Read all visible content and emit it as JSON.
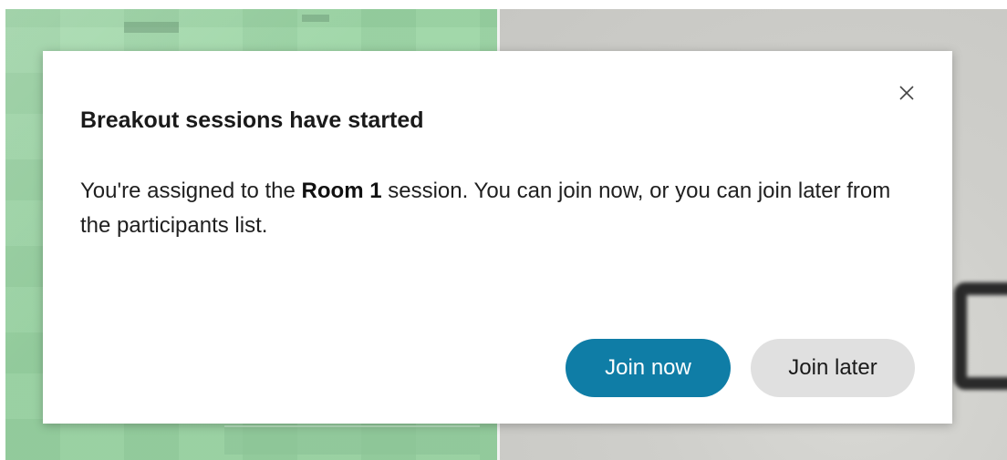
{
  "dialog": {
    "title": "Breakout sessions have started",
    "body_prefix": "You're assigned to the ",
    "room_name": "Room 1",
    "body_suffix": " session. You can join now, or you can join later from the participants list.",
    "close_icon": "close-icon",
    "join_now_label": "Join now",
    "join_later_label": "Join later"
  },
  "colors": {
    "primary_button": "#0f7da6",
    "secondary_button": "#e0e0e0",
    "dialog_background": "#ffffff"
  }
}
